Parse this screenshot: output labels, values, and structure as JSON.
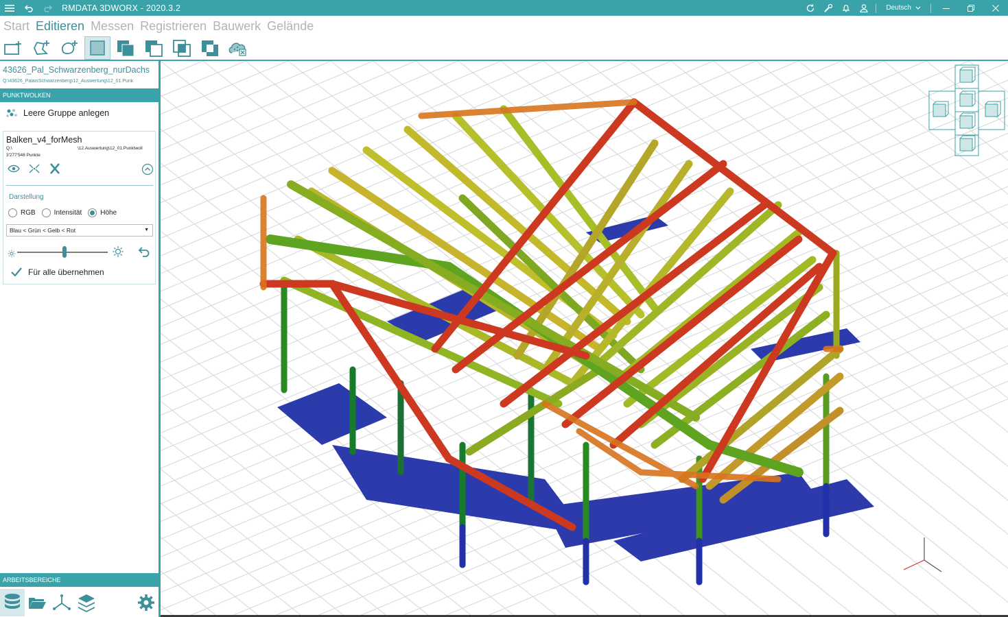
{
  "app": {
    "title": "RMDATA 3DWORX - 2020.3.2",
    "language": "Deutsch"
  },
  "colors": {
    "accent": "#3aa3a9",
    "accent_text": "#3d8f9a",
    "inactive_tab": "#b4b4b4"
  },
  "titlebar_icons": [
    "menu-icon",
    "undo-icon",
    "redo-icon",
    "sync-icon",
    "tools-icon",
    "notification-icon",
    "user-icon",
    "minimize-icon",
    "restore-icon",
    "close-icon"
  ],
  "menu": {
    "tabs": [
      {
        "label": "Start"
      },
      {
        "label": "Editieren",
        "active": true
      },
      {
        "label": "Messen"
      },
      {
        "label": "Registrieren"
      },
      {
        "label": "Bauwerk"
      },
      {
        "label": "Gelände"
      }
    ]
  },
  "toolbar": {
    "tools": [
      "new-rectangle-icon",
      "polygon-add-icon",
      "lasso-add-icon",
      "select-inside-icon",
      "select-union-icon",
      "select-subtract-icon",
      "select-intersect-icon",
      "select-xor-icon",
      "cloud-delete-icon"
    ],
    "active_index": 3
  },
  "project": {
    "name": "43626_Pal_Schwarzenberg_nurDachs",
    "path": "Q:\\43626_PalaisSchwarzenberg\\12_Auswertung\\12_01.Punk"
  },
  "sections": {
    "pointclouds": "PUNKTWOLKEN",
    "workspaces": "ARBEITSBEREICHE"
  },
  "pointcloud_panel": {
    "new_group": "Leere Gruppe anlegen",
    "cloud": {
      "name": "Balken_v4_forMesh",
      "path_prefix": "Q:\\",
      "path_suffix": "\\12.Auswertung\\12_01.Punktwoll",
      "point_count": "3'277'548 Punkte"
    },
    "display_label": "Darstellung",
    "modes": [
      {
        "label": "RGB",
        "selected": false
      },
      {
        "label": "Intensität",
        "selected": false
      },
      {
        "label": "Höhe",
        "selected": true
      }
    ],
    "color_scheme": "Blau < Grün < Gelb < Rot",
    "brightness_level": 0.52,
    "apply_all": "Für alle übernehmen"
  },
  "bottom_tools": [
    "database-icon",
    "folder-open-icon",
    "axes-icon",
    "layers-icon",
    "settings-icon"
  ]
}
